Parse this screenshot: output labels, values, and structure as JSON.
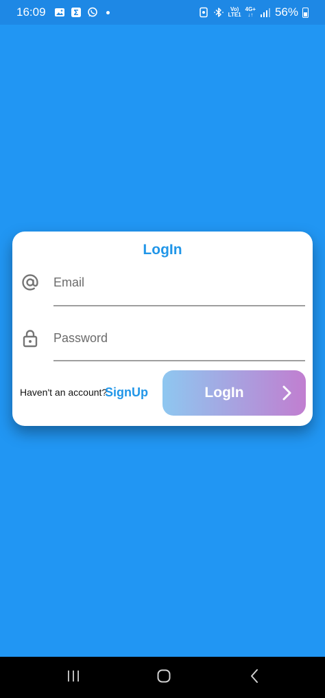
{
  "status_bar": {
    "time": "16:09",
    "left_icons": [
      "gallery-icon",
      "sigma-app-icon",
      "whatsapp-icon",
      "notification-dot"
    ],
    "network_top": "Vo)",
    "network_bottom": "LTE1",
    "network_type": "4G+",
    "battery_percent": "56%"
  },
  "login_card": {
    "title": "LogIn",
    "email": {
      "placeholder": "Email",
      "value": "",
      "icon": "at-sign-icon"
    },
    "password": {
      "placeholder": "Password",
      "value": "",
      "icon": "lock-icon"
    },
    "no_account_text": "Haven't an account?",
    "signup_label": "SignUp",
    "login_button_label": "LogIn"
  },
  "colors": {
    "background": "#2196f3",
    "status_bar": "#1e88e5",
    "accent": "#2196e8",
    "button_gradient_start": "#8ec7f0",
    "button_gradient_end": "#c17ed0"
  }
}
